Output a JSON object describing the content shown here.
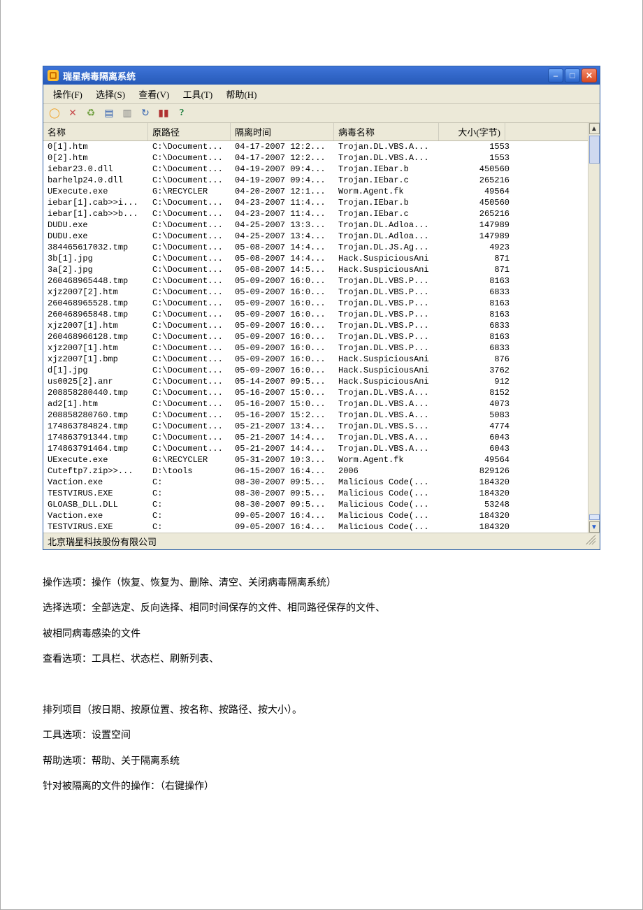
{
  "window": {
    "title": "瑞星病毒隔离系统"
  },
  "menu": {
    "file": "操作(F)",
    "select": "选择(S)",
    "view": "查看(V)",
    "tool": "工具(T)",
    "help": "帮助(H)"
  },
  "columns": {
    "name": "名称",
    "path": "原路径",
    "time": "隔离时间",
    "virus": "病毒名称",
    "size": "大小(字节)"
  },
  "rows": [
    {
      "name": "0[1].htm",
      "path": "C:\\Document...",
      "time": "04-17-2007 12:2...",
      "virus": "Trojan.DL.VBS.A...",
      "size": "1553"
    },
    {
      "name": "0[2].htm",
      "path": "C:\\Document...",
      "time": "04-17-2007 12:2...",
      "virus": "Trojan.DL.VBS.A...",
      "size": "1553"
    },
    {
      "name": "iebar23.0.dll",
      "path": "C:\\Document...",
      "time": "04-19-2007 09:4...",
      "virus": "Trojan.IEbar.b",
      "size": "450560"
    },
    {
      "name": "barhelp24.0.dll",
      "path": "C:\\Document...",
      "time": "04-19-2007 09:4...",
      "virus": "Trojan.IEbar.c",
      "size": "265216"
    },
    {
      "name": "UExecute.exe",
      "path": "G:\\RECYCLER",
      "time": "04-20-2007 12:1...",
      "virus": "Worm.Agent.fk",
      "size": "49564"
    },
    {
      "name": "iebar[1].cab>>i...",
      "path": "C:\\Document...",
      "time": "04-23-2007 11:4...",
      "virus": "Trojan.IEbar.b",
      "size": "450560"
    },
    {
      "name": "iebar[1].cab>>b...",
      "path": "C:\\Document...",
      "time": "04-23-2007 11:4...",
      "virus": "Trojan.IEbar.c",
      "size": "265216"
    },
    {
      "name": "DUDU.exe",
      "path": "C:\\Document...",
      "time": "04-25-2007 13:3...",
      "virus": "Trojan.DL.Adloa...",
      "size": "147989"
    },
    {
      "name": "DUDU.exe",
      "path": "C:\\Document...",
      "time": "04-25-2007 13:4...",
      "virus": "Trojan.DL.Adloa...",
      "size": "147989"
    },
    {
      "name": "384465617032.tmp",
      "path": "C:\\Document...",
      "time": "05-08-2007 14:4...",
      "virus": "Trojan.DL.JS.Ag...",
      "size": "4923"
    },
    {
      "name": "3b[1].jpg",
      "path": "C:\\Document...",
      "time": "05-08-2007 14:4...",
      "virus": "Hack.SuspiciousAni",
      "size": "871"
    },
    {
      "name": "3a[2].jpg",
      "path": "C:\\Document...",
      "time": "05-08-2007 14:5...",
      "virus": "Hack.SuspiciousAni",
      "size": "871"
    },
    {
      "name": "260468965448.tmp",
      "path": "C:\\Document...",
      "time": "05-09-2007 16:0...",
      "virus": "Trojan.DL.VBS.P...",
      "size": "8163"
    },
    {
      "name": "xjz2007[2].htm",
      "path": "C:\\Document...",
      "time": "05-09-2007 16:0...",
      "virus": "Trojan.DL.VBS.P...",
      "size": "6833"
    },
    {
      "name": "260468965528.tmp",
      "path": "C:\\Document...",
      "time": "05-09-2007 16:0...",
      "virus": "Trojan.DL.VBS.P...",
      "size": "8163"
    },
    {
      "name": "260468965848.tmp",
      "path": "C:\\Document...",
      "time": "05-09-2007 16:0...",
      "virus": "Trojan.DL.VBS.P...",
      "size": "8163"
    },
    {
      "name": "xjz2007[1].htm",
      "path": "C:\\Document...",
      "time": "05-09-2007 16:0...",
      "virus": "Trojan.DL.VBS.P...",
      "size": "6833"
    },
    {
      "name": "260468966128.tmp",
      "path": "C:\\Document...",
      "time": "05-09-2007 16:0...",
      "virus": "Trojan.DL.VBS.P...",
      "size": "8163"
    },
    {
      "name": "xjz2007[1].htm",
      "path": "C:\\Document...",
      "time": "05-09-2007 16:0...",
      "virus": "Trojan.DL.VBS.P...",
      "size": "6833"
    },
    {
      "name": "xjz2007[1].bmp",
      "path": "C:\\Document...",
      "time": "05-09-2007 16:0...",
      "virus": "Hack.SuspiciousAni",
      "size": "876"
    },
    {
      "name": "d[1].jpg",
      "path": "C:\\Document...",
      "time": "05-09-2007 16:0...",
      "virus": "Hack.SuspiciousAni",
      "size": "3762"
    },
    {
      "name": "us0025[2].anr",
      "path": "C:\\Document...",
      "time": "05-14-2007 09:5...",
      "virus": "Hack.SuspiciousAni",
      "size": "912"
    },
    {
      "name": "208858280440.tmp",
      "path": "C:\\Document...",
      "time": "05-16-2007 15:0...",
      "virus": "Trojan.DL.VBS.A...",
      "size": "8152"
    },
    {
      "name": "ad2[1].htm",
      "path": "C:\\Document...",
      "time": "05-16-2007 15:0...",
      "virus": "Trojan.DL.VBS.A...",
      "size": "4073"
    },
    {
      "name": "208858280760.tmp",
      "path": "C:\\Document...",
      "time": "05-16-2007 15:2...",
      "virus": "Trojan.DL.VBS.A...",
      "size": "5083"
    },
    {
      "name": "174863784824.tmp",
      "path": "C:\\Document...",
      "time": "05-21-2007 13:4...",
      "virus": "Trojan.DL.VBS.S...",
      "size": "4774"
    },
    {
      "name": "174863791344.tmp",
      "path": "C:\\Document...",
      "time": "05-21-2007 14:4...",
      "virus": "Trojan.DL.VBS.A...",
      "size": "6043"
    },
    {
      "name": "174863791464.tmp",
      "path": "C:\\Document...",
      "time": "05-21-2007 14:4...",
      "virus": "Trojan.DL.VBS.A...",
      "size": "6043"
    },
    {
      "name": "UExecute.exe",
      "path": "G:\\RECYCLER",
      "time": "05-31-2007 10:3...",
      "virus": "Worm.Agent.fk",
      "size": "49564"
    },
    {
      "name": "Cuteftp7.zip>>...",
      "path": "D:\\tools",
      "time": "06-15-2007 16:4...",
      "virus": "2006",
      "size": "829126"
    },
    {
      "name": "Vaction.exe",
      "path": "C:",
      "time": "08-30-2007 09:5...",
      "virus": "Malicious Code(...",
      "size": "184320"
    },
    {
      "name": "TESTVIRUS.EXE",
      "path": "C:",
      "time": "08-30-2007 09:5...",
      "virus": "Malicious Code(...",
      "size": "184320"
    },
    {
      "name": "GLOASB_DLL.DLL",
      "path": "C:",
      "time": "08-30-2007 09:5...",
      "virus": "Malicious Code(...",
      "size": "53248"
    },
    {
      "name": "Vaction.exe",
      "path": "C:",
      "time": "09-05-2007 16:4...",
      "virus": "Malicious Code(...",
      "size": "184320"
    },
    {
      "name": "TESTVIRUS.EXE",
      "path": "C:",
      "time": "09-05-2007 16:4...",
      "virus": "Malicious Code(...",
      "size": "184320"
    }
  ],
  "status": {
    "company": "北京瑞星科技股份有限公司"
  },
  "notes": {
    "p1": "操作选项：操作（恢复、恢复为、删除、清空、关闭病毒隔离系统）",
    "p2": "选择选项：全部选定、反向选择、相同时间保存的文件、相同路径保存的文件、",
    "p3": "被相同病毒感染的文件",
    "p4": "查看选项：工具栏、状态栏、刷新列表、",
    "p5": "排列项目（按日期、按原位置、按名称、按路径、按大小）。",
    "p6": "工具选项：设置空间",
    "p7": "帮助选项：帮助、关于隔离系统",
    "p8": "针对被隔离的文件的操作：（右键操作）"
  }
}
